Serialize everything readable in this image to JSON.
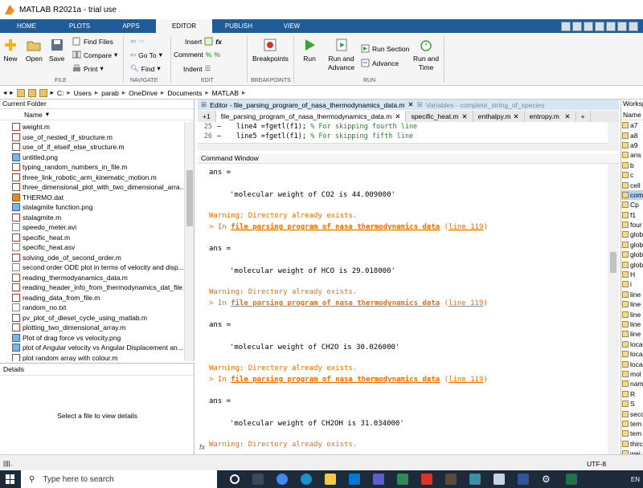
{
  "window": {
    "title": "MATLAB R2021a - trial use"
  },
  "ribbon_tabs": [
    "HOME",
    "PLOTS",
    "APPS",
    "EDITOR",
    "PUBLISH",
    "VIEW"
  ],
  "toolstrip": {
    "file": {
      "new": "New",
      "open": "Open",
      "save": "Save",
      "find_files": "Find Files",
      "compare": "Compare",
      "print": "Print",
      "label": "FILE"
    },
    "navigate": {
      "go_to": "Go To",
      "find": "Find",
      "label": "NAVIGATE"
    },
    "edit": {
      "insert": "Insert",
      "comment": "Comment",
      "indent": "Indent",
      "label": "EDIT"
    },
    "breakpoints": {
      "button": "Breakpoints",
      "label": "BREAKPOINTS"
    },
    "run": {
      "run": "Run",
      "run_and_advance_1": "Run and",
      "run_and_advance_2": "Advance",
      "run_section": "Run Section",
      "advance": "Advance",
      "run_and_time_1": "Run and",
      "run_and_time_2": "Time",
      "label": "RUN"
    }
  },
  "address": [
    "C:",
    "Users",
    "parab",
    "OneDrive",
    "Documents",
    "MATLAB"
  ],
  "current_folder": {
    "title": "Current Folder",
    "column": "Name",
    "files": [
      {
        "name": "weight.m",
        "type": "m"
      },
      {
        "name": "use_of_nested_if_structure.m",
        "type": "m"
      },
      {
        "name": "use_of_if_elseif_else_structure.m",
        "type": "m"
      },
      {
        "name": "untitled.png",
        "type": "img"
      },
      {
        "name": "typing_random_numbers_in_file.m",
        "type": "m"
      },
      {
        "name": "three_link_robotic_arm_kinematic_motion.m",
        "type": "m"
      },
      {
        "name": "three_dimensional_plot_with_two_dimensional_arra...",
        "type": "m"
      },
      {
        "name": "THERMO.dat",
        "type": "ml"
      },
      {
        "name": "stalagmite function.png",
        "type": "img"
      },
      {
        "name": "stalagmite.m",
        "type": "m"
      },
      {
        "name": "speedo_meter.avi",
        "type": "txt"
      },
      {
        "name": "specific_heat.m",
        "type": "m"
      },
      {
        "name": "specific_heat.asv",
        "type": "txt"
      },
      {
        "name": "solving_ode_of_second_order.m",
        "type": "m"
      },
      {
        "name": "second order ODE plot in terms of velocity and disp...",
        "type": "txt"
      },
      {
        "name": "reading_thermodyanamics_data.m",
        "type": "m"
      },
      {
        "name": "reading_header_info_from_thermodynamics_dat_file...",
        "type": "m"
      },
      {
        "name": "reading_data_from_file.m",
        "type": "m"
      },
      {
        "name": "random_no.txt",
        "type": "txt"
      },
      {
        "name": "pv_plot_of_diesel_cycle_using_matlab.m",
        "type": "m"
      },
      {
        "name": "plotting_two_dimensional_array.m",
        "type": "m"
      },
      {
        "name": "Plot of drag force vs velocity.png",
        "type": "img"
      },
      {
        "name": "plot of Angular velocity vs Angular Displacement an...",
        "type": "img"
      },
      {
        "name": "plot random array with colour.m",
        "type": "m"
      }
    ]
  },
  "details": {
    "title": "Details",
    "message": "Select a file to view details"
  },
  "editor": {
    "title": "Editor - file_parsing_program_of_nasa_thermodynamics_data.m",
    "variables_title": "Variables - complete_string_of_species",
    "tabs": [
      "+1",
      "file_parsing_program_of_nasa_thermodynamics_data.m",
      "specific_heat.m",
      "enthalpy.m",
      "entropy.m",
      "+"
    ],
    "lines": [
      {
        "num": "25",
        "code": "line4 =fgetl(f1);",
        "comment": "% For skipping fourth line"
      },
      {
        "num": "26",
        "code": "line5 =fgetl(f1);",
        "comment": "% For skipping fifth line"
      }
    ]
  },
  "command_window": {
    "title": "Command Window",
    "ans_label": "ans =",
    "warning": "Warning: Directory already exists.",
    "in_prefix": "> In ",
    "func": "file_parsing_program_of_nasa_thermodynamics_data",
    "line_ref": "line 119",
    "results": [
      "'molecular weight of CO2 is 44.009000'",
      "'molecular weight of HCO is 29.018000'",
      "'molecular weight of CH2O is 30.026000'",
      "'molecular weight of CH2OH is 31.034000'"
    ],
    "fx": "fx"
  },
  "workspace": {
    "title": "Worksp",
    "column": "Name",
    "items": [
      "a7",
      "a8",
      "a9",
      "ans",
      "b",
      "c",
      "cell",
      "com",
      "Cp",
      "f1",
      "four",
      "glob",
      "glob",
      "glob",
      "glob",
      "H",
      "i",
      "line",
      "line",
      "line",
      "line",
      "line",
      "loca",
      "loca",
      "loca",
      "mol",
      "nam",
      "R",
      "S",
      "seco",
      "tem",
      "tem",
      "thirc",
      "wei"
    ]
  },
  "status": {
    "encoding": "UTF-8"
  },
  "taskbar": {
    "search_placeholder": "Type here to search",
    "lang": "EN"
  }
}
